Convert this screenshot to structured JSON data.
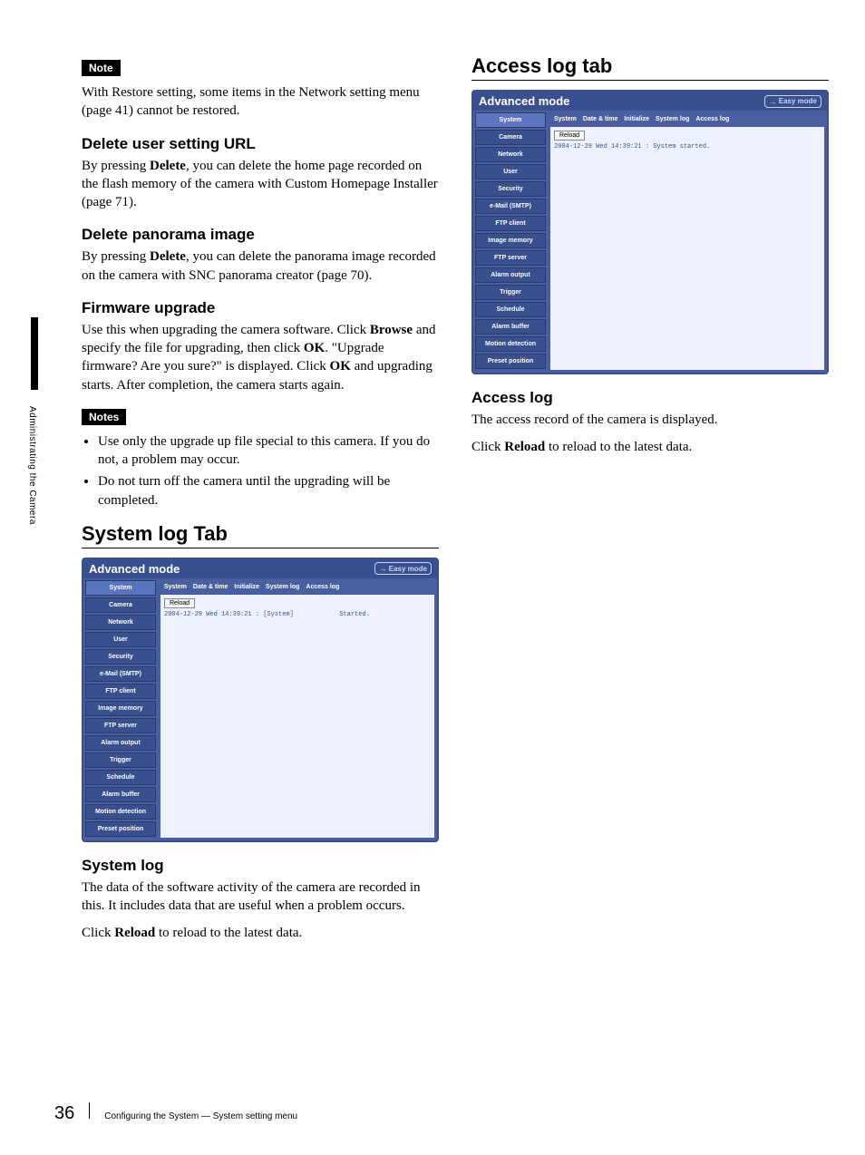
{
  "left": {
    "note_label": "Note",
    "note_p1a": "With Restore setting, some items in the Network setting menu (page 41) cannot be restored.",
    "h_delete_url": "Delete user setting URL",
    "p_delete_url_a": "By pressing ",
    "p_delete_url_b": "Delete",
    "p_delete_url_c": ", you can delete the home page recorded on the flash memory of the camera with Custom Homepage Installer (page 71).",
    "h_delete_pano": "Delete panorama image",
    "p_delete_pano_a": "By pressing ",
    "p_delete_pano_b": "Delete",
    "p_delete_pano_c": ", you can delete the panorama image recorded on the camera with SNC panorama creator (page 70).",
    "h_fw": "Firmware upgrade",
    "p_fw_a": "Use this when upgrading the camera software. Click ",
    "p_fw_b": "Browse",
    "p_fw_c": " and specify the file for upgrading, then click ",
    "p_fw_d": "OK",
    "p_fw_e": ". \"Upgrade firmware? Are you sure?\" is displayed. Click ",
    "p_fw_f": "OK",
    "p_fw_g": " and upgrading starts. After completion, the camera starts again.",
    "notes_label": "Notes",
    "note2_li1": "Use only the upgrade up file special to this camera. If you do not, a problem may occur.",
    "note2_li2": "Do not turn off the camera until the upgrading will be completed.",
    "h2_syslog": "System log Tab",
    "h_syslog": "System log",
    "p_syslog_a": "The data of the software activity of the camera are recorded in this. It includes data that are useful when a problem occurs.",
    "p_syslog_b1": "Click ",
    "p_syslog_b2": "Reload",
    "p_syslog_b3": " to reload to the latest data."
  },
  "right": {
    "h2_accesslog": "Access log tab",
    "h_accesslog": "Access log",
    "p_access_a": "The access record of the camera is displayed.",
    "p_access_b1": "Click ",
    "p_access_b2": "Reload",
    "p_access_b3": " to reload to the latest data."
  },
  "ui_common": {
    "advanced_mode": "Advanced mode",
    "easy_mode": "Easy mode",
    "sidebar": [
      "System",
      "Camera",
      "Network",
      "User",
      "Security",
      "e-Mail (SMTP)",
      "FTP client",
      "Image memory",
      "FTP server",
      "Alarm output",
      "Trigger",
      "Schedule",
      "Alarm buffer",
      "Motion detection",
      "Preset position"
    ],
    "tabs": [
      "System",
      "Date & time",
      "Initialize",
      "System log",
      "Access log"
    ],
    "reload_btn": "Reload"
  },
  "syslog_panel": {
    "log": "2004-12-29 Wed 14:39:21 : [System]            Started."
  },
  "accesslog_panel": {
    "log": "2004-12-29 Wed 14:39:21 : System started."
  },
  "side_text": "Administrating the Camera",
  "footer": {
    "page": "36",
    "text": "Configuring the System — System setting menu"
  }
}
